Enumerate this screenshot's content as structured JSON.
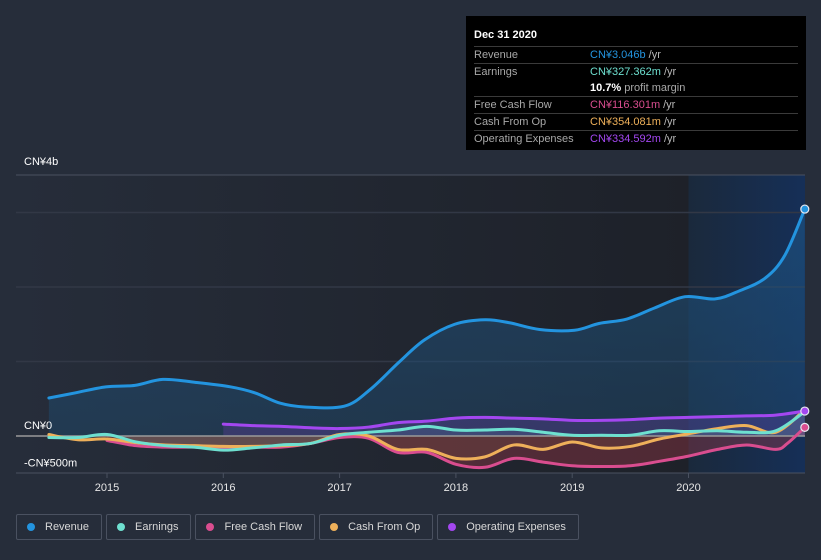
{
  "tooltip": {
    "date": "Dec 31 2020",
    "rows": [
      {
        "label": "Revenue",
        "value": "CN¥3.046b",
        "unit": "/yr",
        "color": "#2394df"
      },
      {
        "label": "Earnings",
        "value": "CN¥327.362m",
        "unit": "/yr",
        "color": "#6ee0d0"
      },
      {
        "label": "",
        "value": "10.7%",
        "unit": "profit margin",
        "color": "#ffffff"
      },
      {
        "label": "Free Cash Flow",
        "value": "CN¥116.301m",
        "unit": "/yr",
        "color": "#d94d8f"
      },
      {
        "label": "Cash From Op",
        "value": "CN¥354.081m",
        "unit": "/yr",
        "color": "#eeb05a"
      },
      {
        "label": "Operating Expenses",
        "value": "CN¥334.592m",
        "unit": "/yr",
        "color": "#a347f0"
      }
    ]
  },
  "legend": [
    {
      "label": "Revenue",
      "color": "#2394df"
    },
    {
      "label": "Earnings",
      "color": "#6ee0d0"
    },
    {
      "label": "Free Cash Flow",
      "color": "#d94d8f"
    },
    {
      "label": "Cash From Op",
      "color": "#eeb05a"
    },
    {
      "label": "Operating Expenses",
      "color": "#a347f0"
    }
  ],
  "chart_data": {
    "type": "area",
    "title": "",
    "xlabel": "",
    "ylabel": "",
    "y_unit": "CN¥ billions",
    "ylim": [
      -0.5,
      4.0
    ],
    "xlim": [
      2014.5,
      2021.0
    ],
    "y_tick_labels": [
      {
        "value": 4.0,
        "label": "CN¥4b"
      },
      {
        "value": 0.0,
        "label": "CN¥0"
      },
      {
        "value": -0.5,
        "label": "-CN¥500m"
      }
    ],
    "gridlines": [
      1.0,
      2.0,
      3.0,
      3.5
    ],
    "x_tick_labels": [
      "2015",
      "2016",
      "2017",
      "2018",
      "2019",
      "2020"
    ],
    "x_ticks": [
      2015,
      2016,
      2017,
      2018,
      2019,
      2020
    ],
    "highlight_region": {
      "from": 2020.0,
      "to": 2021.0
    },
    "legend_position": "bottom-left",
    "series": [
      {
        "name": "Revenue",
        "color": "#2394df",
        "x": [
          2014.5,
          2014.73,
          2014.99,
          2015.24,
          2015.48,
          2015.76,
          2016.06,
          2016.27,
          2016.49,
          2016.7,
          2017.04,
          2017.26,
          2017.51,
          2017.73,
          2017.99,
          2018.25,
          2018.46,
          2018.72,
          2019.02,
          2019.23,
          2019.47,
          2019.71,
          2019.97,
          2020.23,
          2020.44,
          2020.66,
          2020.83,
          2021.0
        ],
        "values": [
          0.51,
          0.58,
          0.66,
          0.68,
          0.76,
          0.72,
          0.66,
          0.58,
          0.44,
          0.39,
          0.4,
          0.62,
          0.99,
          1.29,
          1.5,
          1.56,
          1.52,
          1.43,
          1.42,
          1.51,
          1.57,
          1.72,
          1.87,
          1.84,
          1.95,
          2.12,
          2.43,
          3.046
        ]
      },
      {
        "name": "Earnings",
        "color": "#6ee0d0",
        "x": [
          2014.5,
          2014.75,
          2015.0,
          2015.25,
          2015.5,
          2015.75,
          2016.0,
          2016.25,
          2016.5,
          2016.75,
          2017.0,
          2017.25,
          2017.5,
          2017.75,
          2018.0,
          2018.25,
          2018.5,
          2018.75,
          2019.0,
          2019.25,
          2019.5,
          2019.75,
          2020.0,
          2020.25,
          2020.5,
          2020.75,
          2021.0
        ],
        "values": [
          -0.02,
          -0.02,
          0.02,
          -0.08,
          -0.13,
          -0.15,
          -0.19,
          -0.16,
          -0.12,
          -0.1,
          0.01,
          0.05,
          0.08,
          0.13,
          0.08,
          0.08,
          0.09,
          0.05,
          0.01,
          0.01,
          0.01,
          0.07,
          0.06,
          0.07,
          0.05,
          0.07,
          0.327
        ]
      },
      {
        "name": "Free Cash Flow",
        "color": "#d94d8f",
        "x": [
          2015.0,
          2015.25,
          2015.5,
          2015.75,
          2016.0,
          2016.25,
          2016.5,
          2016.75,
          2017.0,
          2017.25,
          2017.5,
          2017.75,
          2018.0,
          2018.25,
          2018.5,
          2018.75,
          2019.0,
          2019.25,
          2019.5,
          2019.75,
          2020.0,
          2020.25,
          2020.5,
          2020.75,
          2020.85,
          2021.0
        ],
        "values": [
          -0.06,
          -0.13,
          -0.15,
          -0.15,
          -0.16,
          -0.15,
          -0.15,
          -0.1,
          -0.02,
          -0.03,
          -0.22,
          -0.22,
          -0.38,
          -0.42,
          -0.3,
          -0.35,
          -0.4,
          -0.41,
          -0.4,
          -0.34,
          -0.27,
          -0.18,
          -0.12,
          -0.18,
          -0.1,
          0.116
        ]
      },
      {
        "name": "Cash From Op",
        "color": "#eeb05a",
        "x": [
          2014.5,
          2014.75,
          2015.0,
          2015.25,
          2015.5,
          2015.75,
          2016.0,
          2016.25,
          2016.5,
          2016.75,
          2017.0,
          2017.25,
          2017.5,
          2017.75,
          2018.0,
          2018.25,
          2018.5,
          2018.75,
          2019.0,
          2019.25,
          2019.5,
          2019.75,
          2020.0,
          2020.25,
          2020.5,
          2020.75,
          2021.0
        ],
        "values": [
          0.02,
          -0.05,
          -0.04,
          -0.09,
          -0.12,
          -0.13,
          -0.14,
          -0.14,
          -0.13,
          -0.1,
          0.02,
          0.0,
          -0.18,
          -0.18,
          -0.3,
          -0.28,
          -0.12,
          -0.18,
          -0.08,
          -0.16,
          -0.14,
          -0.04,
          0.03,
          0.1,
          0.14,
          0.05,
          0.354
        ]
      },
      {
        "name": "Operating Expenses",
        "color": "#a347f0",
        "x": [
          2016.0,
          2016.25,
          2016.5,
          2016.75,
          2017.0,
          2017.25,
          2017.5,
          2017.75,
          2018.0,
          2018.25,
          2018.5,
          2018.75,
          2019.0,
          2019.25,
          2019.5,
          2019.75,
          2020.0,
          2020.25,
          2020.5,
          2020.75,
          2021.0
        ],
        "values": [
          0.16,
          0.14,
          0.13,
          0.11,
          0.1,
          0.12,
          0.18,
          0.2,
          0.24,
          0.25,
          0.24,
          0.23,
          0.21,
          0.21,
          0.22,
          0.24,
          0.25,
          0.26,
          0.27,
          0.28,
          0.335
        ]
      }
    ]
  }
}
